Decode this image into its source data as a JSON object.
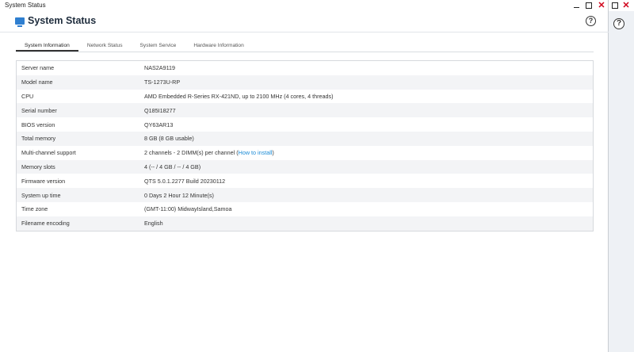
{
  "window": {
    "title": "System Status",
    "app_title": "System Status"
  },
  "header": {
    "help_symbol": "?"
  },
  "tabs": [
    {
      "label": "System Information",
      "active": true
    },
    {
      "label": "Network Status",
      "active": false
    },
    {
      "label": "System Service",
      "active": false
    },
    {
      "label": "Hardware Information",
      "active": false
    }
  ],
  "system_info": {
    "rows": [
      {
        "label": "Server name",
        "value": "NAS2A9119"
      },
      {
        "label": "Model name",
        "value": "TS-1273U-RP"
      },
      {
        "label": "CPU",
        "value": "AMD Embedded R-Series RX-421ND, up to 2100 MHz (4 cores, 4 threads)"
      },
      {
        "label": "Serial number",
        "value": "Q185I18277"
      },
      {
        "label": "BIOS version",
        "value": "QY63AR13"
      },
      {
        "label": "Total memory",
        "value": "8 GB (8 GB usable)"
      },
      {
        "label": "Multi-channel support",
        "value": "2 channels - 2 DIMM(s) per channel (",
        "link": "How to install",
        "suffix": ")"
      },
      {
        "label": "Memory slots",
        "value": "4 (-- / 4 GB / -- / 4 GB)"
      },
      {
        "label": "Firmware version",
        "value": "QTS 5.0.1.2277 Build 20230112"
      },
      {
        "label": "System up time",
        "value": "0 Days 2 Hour 12 Minute(s)"
      },
      {
        "label": "Time zone",
        "value": "(GMT-11:00) MidwayIsland,Samoa"
      },
      {
        "label": "Filename encoding",
        "value": "English"
      }
    ]
  },
  "colors": {
    "accent": "#2f7fd0",
    "link": "#1a8bd6",
    "close": "#d0021b"
  },
  "icons": {
    "app": "monitor-icon",
    "help": "help-icon",
    "minimize": "minimize-icon",
    "maximize": "maximize-icon",
    "close": "close-icon"
  }
}
